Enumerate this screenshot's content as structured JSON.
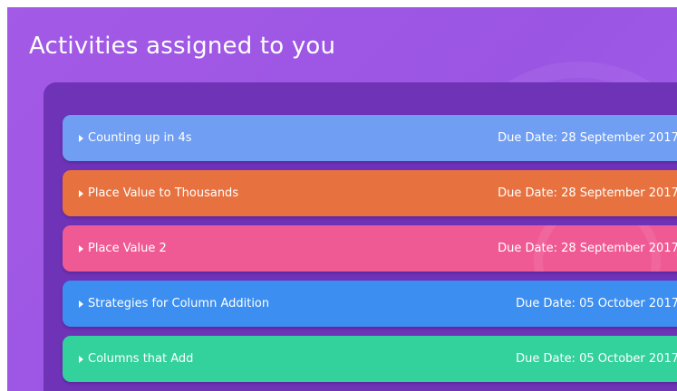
{
  "panel": {
    "title": "Activities assigned to you"
  },
  "activities": [
    {
      "name": "Counting up in 4s",
      "due": "Due Date: 28 September 2017",
      "color": "#6f9ef2"
    },
    {
      "name": "Place Value to Thousands",
      "due": "Due Date: 28 September 2017",
      "color": "#e7723f"
    },
    {
      "name": "Place Value 2",
      "due": "Due Date: 28 September 2017",
      "color": "#f05a94"
    },
    {
      "name": "Strategies for Column Addition",
      "due": "Due Date: 05 October 2017",
      "color": "#3c8ff0"
    },
    {
      "name": "Columns that Add",
      "due": "Due Date: 05 October 2017",
      "color": "#33d19c"
    }
  ],
  "icons": {
    "expand": "caret-right-icon"
  }
}
